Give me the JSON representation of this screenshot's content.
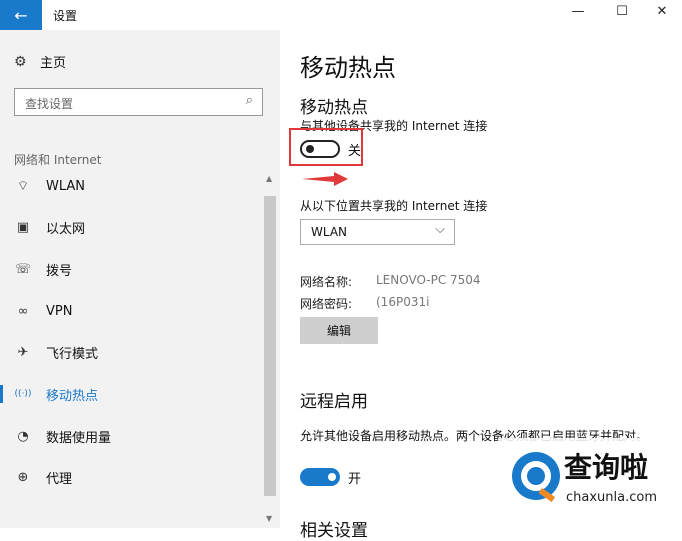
{
  "window": {
    "title": "设置",
    "back_glyph": "←",
    "minimize_glyph": "—",
    "maximize_glyph": "☐",
    "close_glyph": "✕"
  },
  "sidebar": {
    "home_label": "主页",
    "search_placeholder": "查找设置",
    "section_label": "网络和 Internet",
    "items": [
      {
        "label": "WLAN",
        "icon": "wifi-icon",
        "glyph": "⌔"
      },
      {
        "label": "以太网",
        "icon": "ethernet-icon",
        "glyph": "▣"
      },
      {
        "label": "拨号",
        "icon": "dialup-icon",
        "glyph": "☏"
      },
      {
        "label": "VPN",
        "icon": "vpn-icon",
        "glyph": "∞"
      },
      {
        "label": "飞行模式",
        "icon": "airplane-icon",
        "glyph": "✈"
      },
      {
        "label": "移动热点",
        "icon": "hotspot-icon",
        "glyph": "((·))",
        "active": true
      },
      {
        "label": "数据使用量",
        "icon": "data-usage-icon",
        "glyph": "◔"
      },
      {
        "label": "代理",
        "icon": "globe-icon",
        "glyph": "⊕"
      }
    ]
  },
  "main": {
    "page_title": "移动热点",
    "hotspot": {
      "heading": "移动热点",
      "share_label": "与其他设备共享我的 Internet 连接",
      "toggle_state": "关",
      "source_label": "从以下位置共享我的 Internet 连接",
      "source_value": "WLAN",
      "network_name_label": "网络名称:",
      "network_name_value": "LENOVO-PC 7504",
      "network_password_label": "网络密码:",
      "network_password_value": "(16P031i",
      "edit_button": "编辑"
    },
    "remote": {
      "heading": "远程启用",
      "description": "允许其他设备启用移动热点。两个设备必须都已启用蓝牙并配对。",
      "toggle_state": "开",
      "next_heading_partial": "相关设置"
    }
  },
  "watermark": {
    "brand": "查询啦",
    "domain": "chaxunla.com"
  },
  "colors": {
    "accent": "#1979ca",
    "highlight_red": "#e0393a",
    "sidebar_bg": "#f2f2f2"
  }
}
